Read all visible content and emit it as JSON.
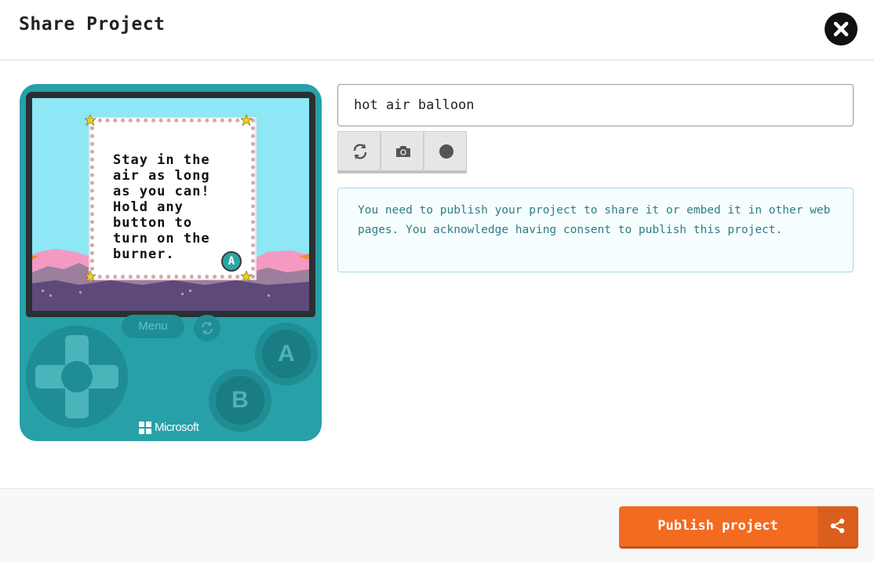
{
  "dialog": {
    "title": "Share Project",
    "close_icon": "close-icon"
  },
  "simulator": {
    "game_text": "Stay in the\nair as long\nas you can!\nHold any\nbutton to\nturn on the\nburner.",
    "badge": "A",
    "menu_label": "Menu",
    "button_a": "A",
    "button_b": "B",
    "brand": "Microsoft",
    "colors": {
      "body": "#27a0a8",
      "sky": "#8de7f5",
      "hills": "#f49ac2",
      "ground": "#5e4a7a"
    }
  },
  "project": {
    "name_value": "hot air balloon"
  },
  "tools": [
    {
      "name": "restart",
      "icon": "refresh-icon"
    },
    {
      "name": "screenshot",
      "icon": "camera-icon"
    },
    {
      "name": "record",
      "icon": "record-icon"
    }
  ],
  "notice": {
    "text": "You need to publish your project to share it or embed it in other web pages. You acknowledge having consent to publish this project."
  },
  "footer": {
    "publish_label": "Publish project",
    "publish_icon": "share-icon",
    "accent": "#f26b21"
  }
}
